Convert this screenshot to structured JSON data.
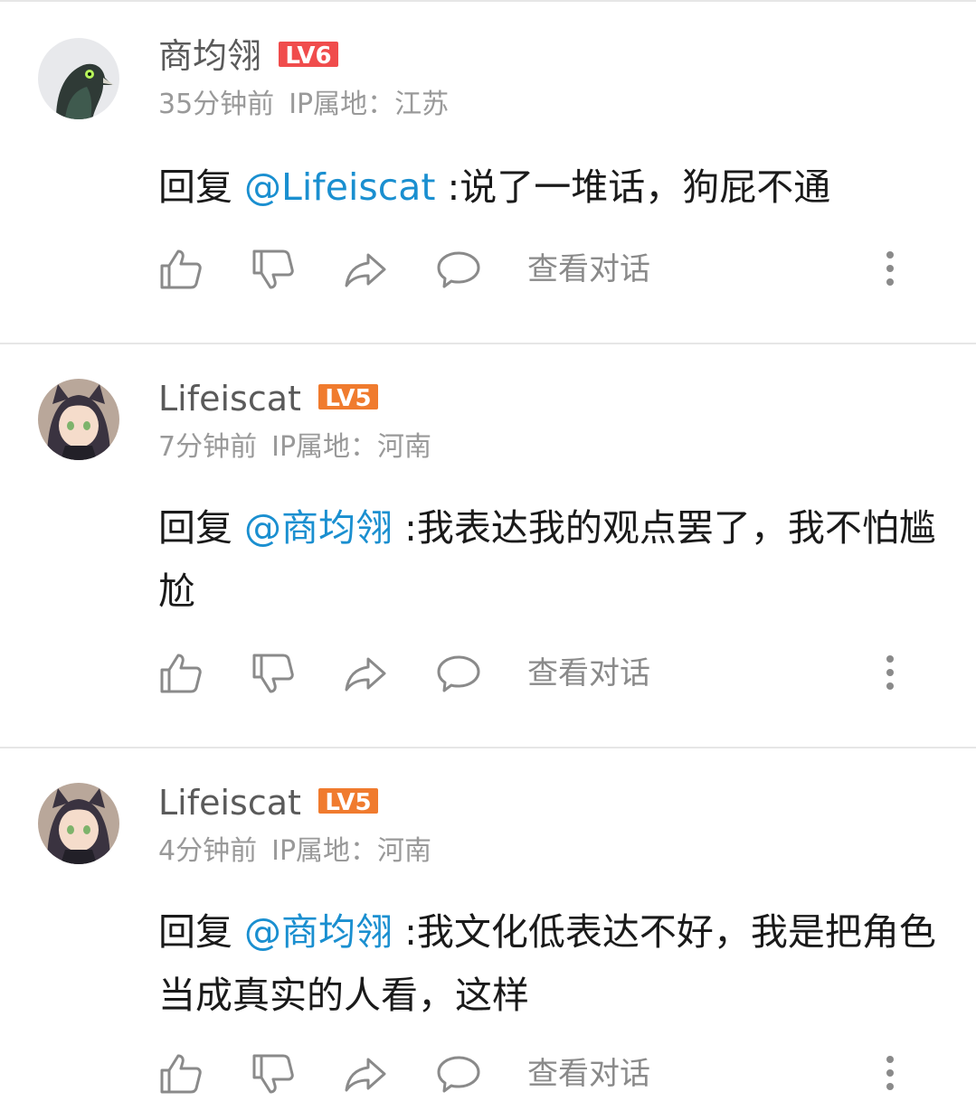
{
  "comments": [
    {
      "username": "商均翎",
      "level": "LV6",
      "level_color": "#f04c4c",
      "time": "35分钟前",
      "ip": "IP属地：江苏",
      "reply_prefix": "回复",
      "mention": "@Lifeiscat",
      "text": ":说了一堆话，狗屁不通",
      "view_dialog": "查看对话",
      "avatar": "pigeon-avatar"
    },
    {
      "username": "Lifeiscat",
      "level": "LV5",
      "level_color": "#f07b2e",
      "time": "7分钟前",
      "ip": "IP属地：河南",
      "reply_prefix": "回复",
      "mention": "@商均翎",
      "text": ":我表达我的观点罢了，我不怕尴尬",
      "view_dialog": "查看对话",
      "avatar": "anime-catgirl-avatar"
    },
    {
      "username": "Lifeiscat",
      "level": "LV5",
      "level_color": "#f07b2e",
      "time": "4分钟前",
      "ip": "IP属地：河南",
      "reply_prefix": "回复",
      "mention": "@商均翎",
      "text": ":我文化低表达不好，我是把角色当成真实的人看，这样",
      "view_dialog": "查看对话",
      "avatar": "anime-catgirl-avatar"
    }
  ],
  "icons": [
    "thumbs-up-icon",
    "thumbs-down-icon",
    "share-icon",
    "comment-icon",
    "more-icon"
  ]
}
